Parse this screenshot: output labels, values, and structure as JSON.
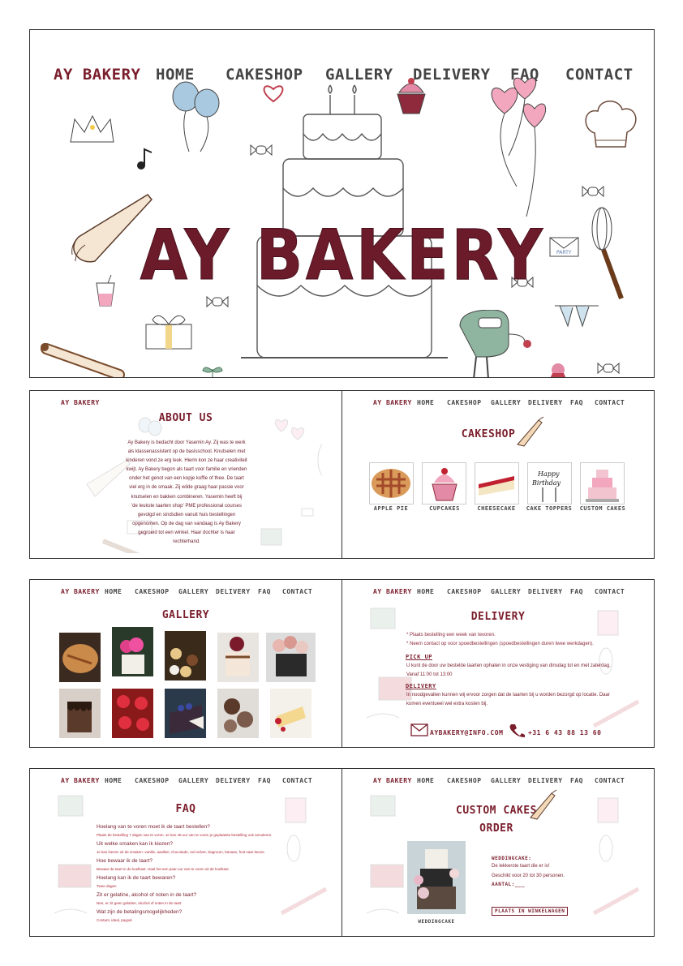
{
  "brand": "AY BAKERY",
  "nav": [
    "HOME",
    "CAKESHOP",
    "GALLERY",
    "DELIVERY",
    "FAQ",
    "CONTACT"
  ],
  "hero": {
    "title": "AY BAKERY",
    "party_label": "PARTY"
  },
  "about": {
    "heading": "ABOUT US",
    "lines": [
      "Ay Bakery is bedacht door Yasemin Ay. Zij was te werk",
      "als klassenassistent op de basisschool. Knutselen met",
      "kinderen vond ze erg leuk. Hierin kon ze haar creativiteit",
      "kwijt. Ay Bakery begon als taart voor familie en vrienden",
      "onder het genot van een kopje koffie of thee. De taart",
      "viel erg in de smaak. Zij wilde graag haar passie voor",
      "knutselen en bakken combineren. Yasemin heeft bij",
      "'de leukste taarten shop'    PME professional courses",
      "gevolgd en sindsdien vanuit huis bestellingen",
      "opgenomen. Op de dag van vandaag is Ay Bakery",
      "gegroeid tot een winkel. Haar dochter is haar",
      "rechterhand."
    ]
  },
  "cakeshop": {
    "heading": "CAKESHOP",
    "items": [
      "APPLE PIE",
      "CUPCAKES",
      "CHEESECAKE",
      "CAKE TOPPERS",
      "CUSTOM CAKES"
    ],
    "topper_text": [
      "Happy",
      "Birthday"
    ]
  },
  "gallery": {
    "heading": "GALLERY"
  },
  "delivery": {
    "heading": "DELIVERY",
    "notes": [
      "* Plaats bestelling een week van tevoren.",
      "* Neem contact op voor spoedbestellingen (spoedbestellingen duren twee werkdagen)."
    ],
    "pickup_title": "PICK UP",
    "pickup_lines": [
      "U kunt de door uw bestelde taarten ophalen in onze vestiging van dinsdag tot en met zaterdag.",
      "Vanaf 11:00 tot 13:00"
    ],
    "delivery_title": "DELIVERY",
    "delivery_lines": [
      "In noodgevallen kunnen wij ervoor zorgen dat de taarten bij u worden bezorgd op locatie. Daar",
      "komen eventueel wel extra kosten bij."
    ],
    "email": "AYBAKERY@INFO.COM",
    "phone": "+31 6 43 88 13 60"
  },
  "faq": {
    "heading": "FAQ",
    "items": [
      {
        "q": "Hoelang van te voren moet ik de taart bestellen?",
        "a": "Plaats de bestelling 7 dagen van te voren. Je kan 48 uur van te voren je geplaatste bestelling ook annuleren."
      },
      {
        "q": "Uit welke smaken kan ik kiezen?",
        "a": "Je kan kiezen uit de smaken: vanille, aardbei, chocolade, red velvet, slagroom, banaan, fruit naar keuze."
      },
      {
        "q": "Hoe bewaar ik de taart?",
        "a": "Bewaar de taart in de koelkast. Haal het een paar uur van te voren uit de koelkast."
      },
      {
        "q": "Hoelang kan ik de taart bewaren?",
        "a": "Twee dagen"
      },
      {
        "q": "Zit er gelatine, alcohol of noten in de taart?",
        "a": "Nee, er zit geen gelatine, alcohol of noten in de taart."
      },
      {
        "q": "Wat zijn de betalingsmogelijkheden?",
        "a": "Contant, ideal, paypal"
      }
    ]
  },
  "order": {
    "heading_line1": "CUSTOM CAKES",
    "heading_line2": "ORDER",
    "product_caption": "WEDDINGCAKE",
    "product_title": "WEDDINGCAKE:",
    "product_desc": "De lekkerste taart die er is!",
    "product_serves": "Geschikt voor    20 tot 30 personen.",
    "quantity_label": "AANTAL:___",
    "button": "PLAATS IN WINKELWAGEN"
  },
  "colors": {
    "accent": "#7a1e2c",
    "nav": "#444444",
    "border": "#333333"
  }
}
